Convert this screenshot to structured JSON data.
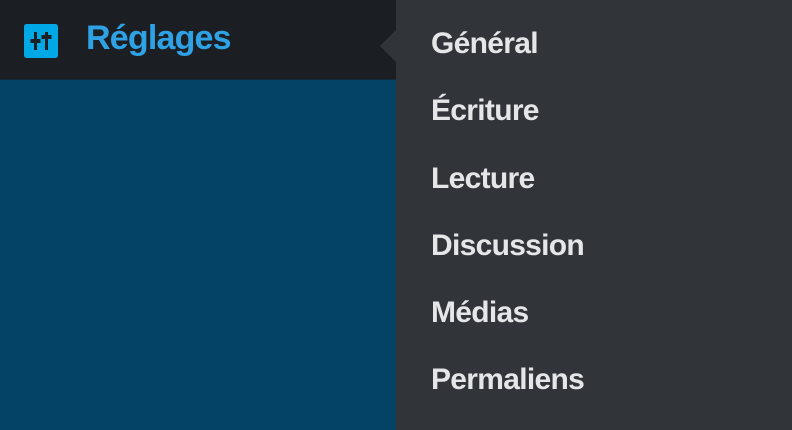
{
  "menu": {
    "active_item": {
      "label": "Réglages",
      "icon": "settings-sliders-icon",
      "accent_color": "#2ea2e4"
    },
    "submenu": [
      {
        "label": "Général"
      },
      {
        "label": "Écriture"
      },
      {
        "label": "Lecture"
      },
      {
        "label": "Discussion"
      },
      {
        "label": "Médias"
      },
      {
        "label": "Permaliens"
      }
    ]
  },
  "colors": {
    "sidebar_bg": "#044266",
    "active_header_bg": "#1b1f23",
    "submenu_bg": "#31353a",
    "submenu_text": "#e4e6e8"
  }
}
